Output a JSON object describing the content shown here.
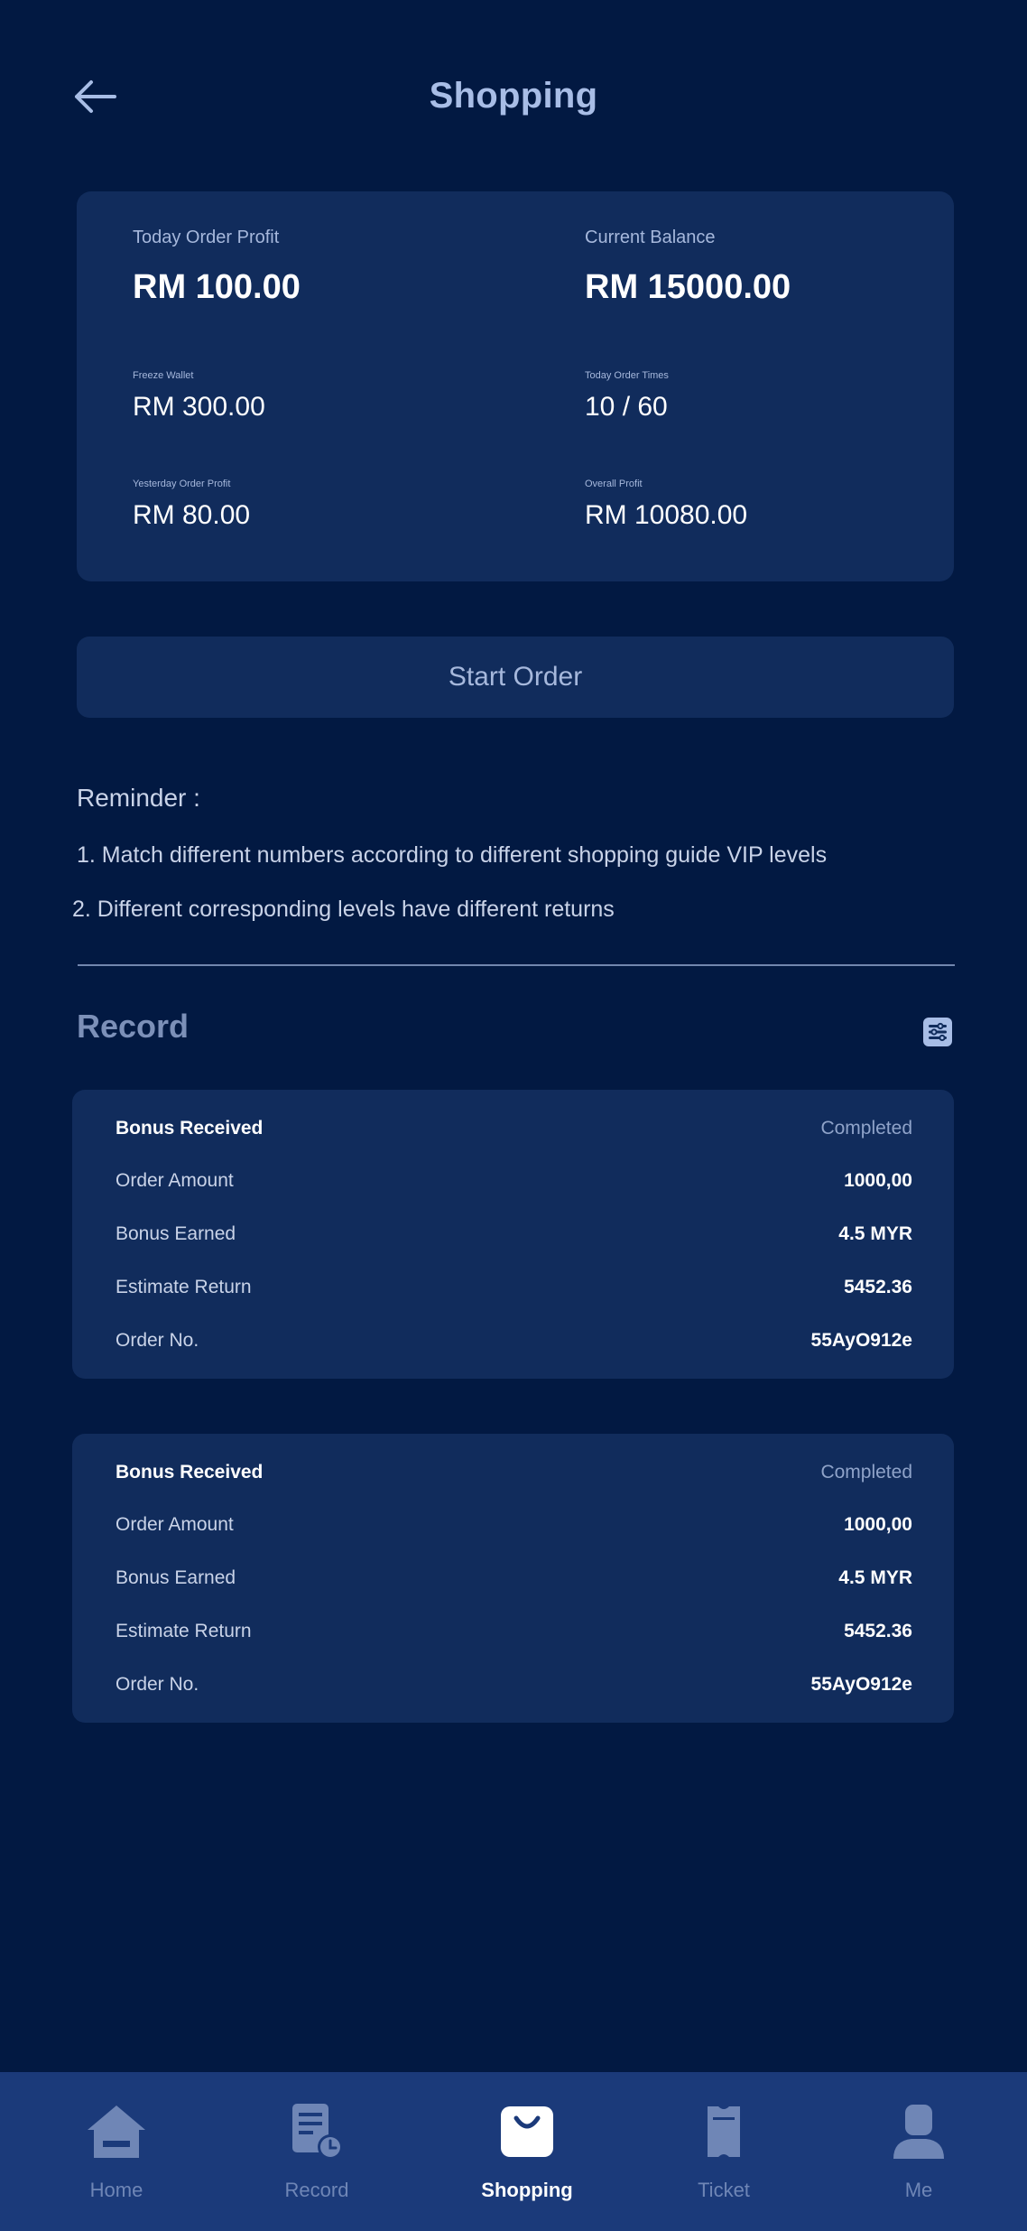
{
  "header": {
    "title": "Shopping"
  },
  "stats": {
    "today_profit": {
      "label": "Today Order Profit",
      "value": "RM 100.00"
    },
    "current_balance": {
      "label": "Current Balance",
      "value": "RM 15000.00"
    },
    "freeze_wallet": {
      "label": "Freeze Wallet",
      "value": "RM 300.00"
    },
    "today_times": {
      "label": "Today Order Times",
      "value": "10 / 60"
    },
    "yesterday_profit": {
      "label": "Yesterday Order Profit",
      "value": "RM 80.00"
    },
    "overall_profit": {
      "label": "Overall Profit",
      "value": "RM 10080.00"
    }
  },
  "start_order": {
    "label": "Start Order"
  },
  "reminder": {
    "title": "Reminder :",
    "lines": [
      "1. Match different numbers according to different shopping guide VIP levels",
      "2. Different corresponding levels have different returns"
    ]
  },
  "record": {
    "title": "Record",
    "filter_icon": "filter-list-icon",
    "cards": [
      {
        "title": "Bonus Received",
        "status": "Completed",
        "rows": [
          {
            "key": "Order Amount",
            "value": "1000,00"
          },
          {
            "key": "Bonus Earned",
            "value": "4.5 MYR"
          },
          {
            "key": "Estimate Return",
            "value": "5452.36"
          },
          {
            "key": "Order No.",
            "value": "55AyO912e"
          }
        ]
      },
      {
        "title": "Bonus Received",
        "status": "Completed",
        "rows": [
          {
            "key": "Order Amount",
            "value": "1000,00"
          },
          {
            "key": "Bonus Earned",
            "value": "4.5 MYR"
          },
          {
            "key": "Estimate Return",
            "value": "5452.36"
          },
          {
            "key": "Order No.",
            "value": "55AyO912e"
          }
        ]
      }
    ]
  },
  "nav": {
    "active": "Shopping",
    "items": [
      {
        "label": "Home",
        "icon": "home-icon"
      },
      {
        "label": "Record",
        "icon": "record-icon"
      },
      {
        "label": "Shopping",
        "icon": "shopping-bag-icon"
      },
      {
        "label": "Ticket",
        "icon": "ticket-icon"
      },
      {
        "label": "Me",
        "icon": "user-icon"
      }
    ]
  },
  "colors": {
    "background": "#021942",
    "card": "#112c5c",
    "nav_background": "#1b3a7a",
    "accent_text": "#a8bde6",
    "muted_text": "#6f86b6"
  }
}
